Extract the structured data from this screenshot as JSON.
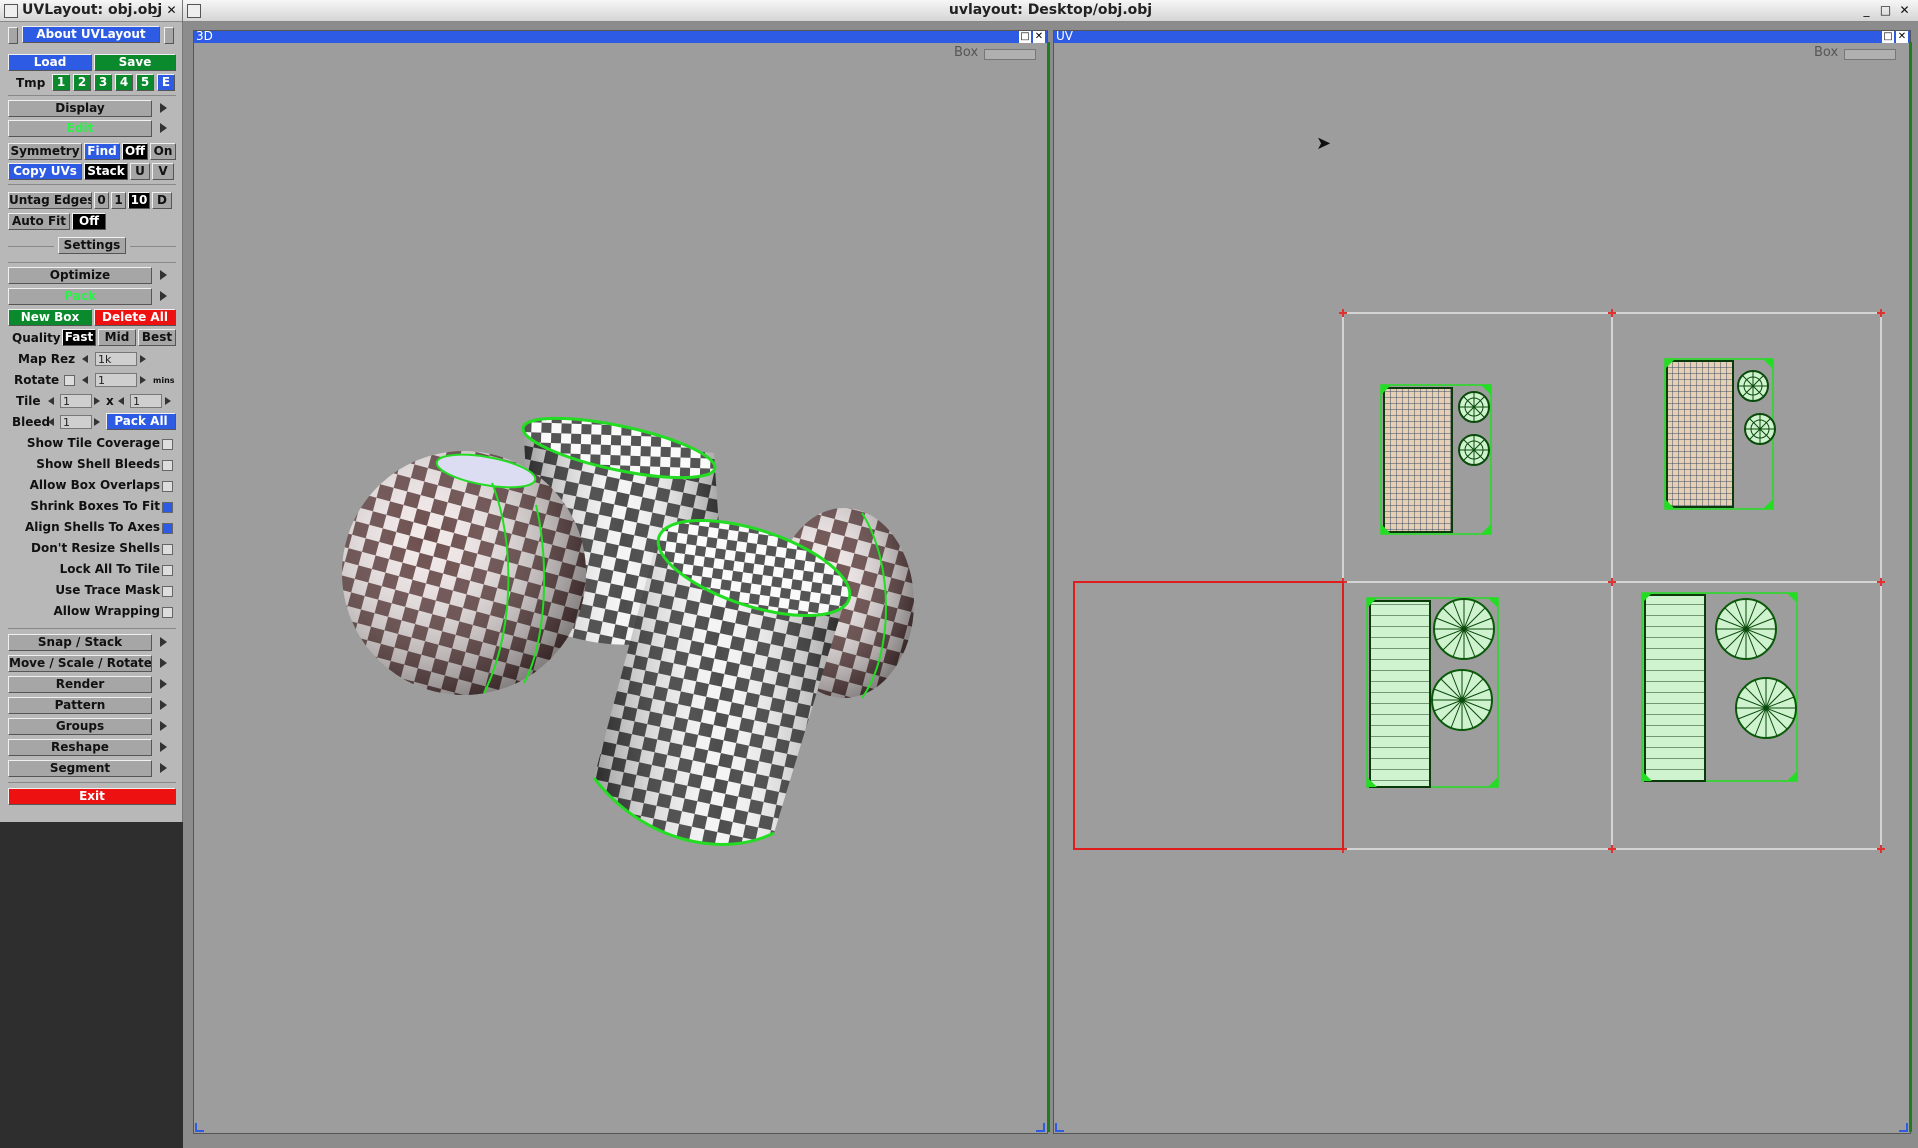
{
  "tool_window": {
    "title": "UVLayout: obj.obj",
    "about_button": "About UVLayout",
    "load": "Load",
    "save": "Save",
    "tmp_label": "Tmp",
    "tmp_slots": [
      "1",
      "2",
      "3",
      "4",
      "5",
      "E"
    ],
    "display": "Display",
    "edit": "Edit",
    "symmetry": "Symmetry",
    "find": "Find",
    "off": "Off",
    "on": "On",
    "copy_uvs": "Copy UVs",
    "stack": "Stack",
    "u": "U",
    "v": "V",
    "untag_edges": "Untag Edges",
    "untag_opts": [
      "0",
      "1",
      "10",
      "D"
    ],
    "auto_fit": "Auto Fit",
    "auto_fit_value": "Off",
    "settings": "Settings",
    "optimize": "Optimize",
    "pack": "Pack",
    "new_box": "New Box",
    "delete_all": "Delete All",
    "quality": "Quality",
    "quality_opts": [
      "Fast",
      "Mid",
      "Best"
    ],
    "map_rez": "Map Rez",
    "map_rez_value": "1k",
    "rotate": "Rotate",
    "rotate_value": "1",
    "rotate_unit": "mins",
    "tile": "Tile",
    "tile_x": "1",
    "tile_sep": "x",
    "tile_y": "1",
    "bleed": "Bleed",
    "bleed_value": "1",
    "pack_all": "Pack All",
    "options": [
      {
        "label": "Show Tile Coverage",
        "checked": false
      },
      {
        "label": "Show Shell Bleeds",
        "checked": false
      },
      {
        "label": "Allow Box Overlaps",
        "checked": false
      },
      {
        "label": "Shrink Boxes To Fit",
        "checked": true
      },
      {
        "label": "Align Shells To Axes",
        "checked": true
      },
      {
        "label": "Don't Resize Shells",
        "checked": false
      },
      {
        "label": "Lock All To Tile",
        "checked": false
      },
      {
        "label": "Use Trace Mask",
        "checked": false
      },
      {
        "label": "Allow Wrapping",
        "checked": false
      }
    ],
    "menus": [
      "Snap / Stack",
      "Move / Scale / Rotate",
      "Render",
      "Pattern",
      "Groups",
      "Reshape",
      "Segment"
    ],
    "exit": "Exit"
  },
  "main_window": {
    "title": "uvlayout: Desktop/obj.obj",
    "view_3d": {
      "title": "3D",
      "box_label": "Box"
    },
    "view_uv": {
      "title": "UV",
      "box_label": "Box"
    }
  },
  "colors": {
    "accent_blue": "#2d5be3",
    "accent_green": "#0a8a2c",
    "accent_red": "#ee1111",
    "shell_outline": "#22dd22"
  }
}
